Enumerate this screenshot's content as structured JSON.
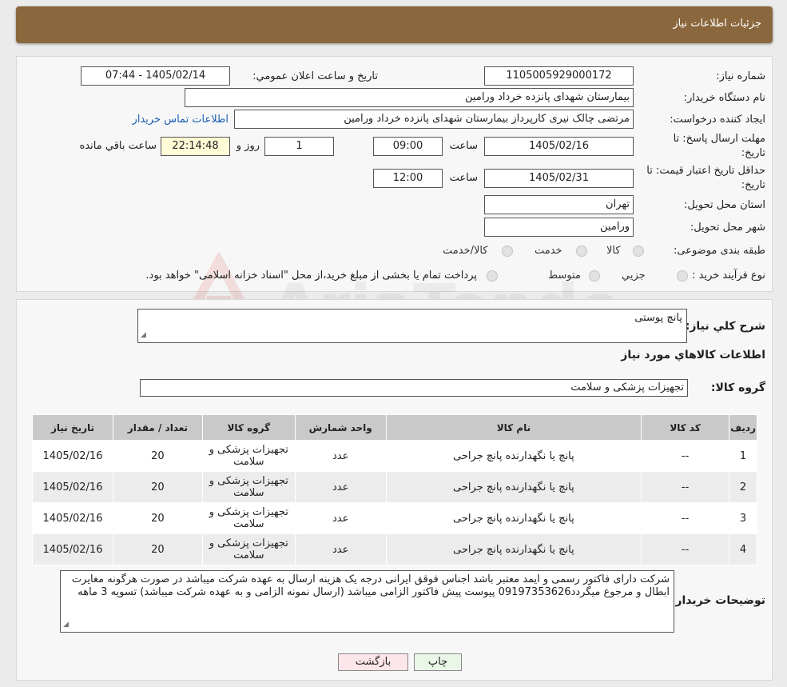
{
  "page_title": "جزئیات اطلاعات نیاز",
  "watermark_text": "AriaTender.neT",
  "need_info": {
    "need_number_label": "شماره نیاز:",
    "need_number": "1105005929000172",
    "announce_label": "تاريخ و ساعت اعلان عمومي:",
    "announce_value": "1405/02/14 - 07:44",
    "buyer_org_label": "نام دستگاه خريدار:",
    "buyer_org": "بیمارستان شهدای پانزده خرداد ورامین",
    "creator_label": "ايجاد كننده درخواست:",
    "creator": "مرتضی چالک نیری کارپرداز بیمارستان شهدای پانزده خرداد ورامین",
    "contact_link": "اطلاعات تماس خريدار",
    "reply_deadline_label_1": "مهلت ارسال پاسخ: تا",
    "reply_deadline_label_2": "تاريخ:",
    "reply_date": "1405/02/16",
    "time_label": "ساعت",
    "reply_time": "09:00",
    "days_value": "1",
    "days_label": "روز و",
    "remaining_time": "22:14:48",
    "remaining_label": "ساعت باقي مانده",
    "price_validity_label_1": "حداقل تاريخ اعتبار قيمت: تا",
    "price_validity_label_2": "تاريخ:",
    "price_validity_date": "1405/02/31",
    "price_validity_time": "12:00",
    "province_label": "استان محل تحويل:",
    "province": "تهران",
    "city_label": "شهر محل تحويل:",
    "city": "ورامین",
    "category_label": "طبقه بندی موضوعی:",
    "category_options": [
      "كالا",
      "خدمت",
      "كالا/خدمت"
    ],
    "purchase_type_label": "نوع فرآيند خريد :",
    "purchase_options": [
      "جزيي",
      "متوسط"
    ],
    "purchase_note": "پرداخت تمام يا بخشی از مبلغ خريد،از محل \"اسناد خزانه اسلامی\" خواهد بود."
  },
  "summary": {
    "general_desc_label": "شرح كلي نياز:",
    "general_desc": "پانچ پوستی",
    "goods_info_title": "اطلاعات كالاهاي مورد نياز",
    "goods_group_label": "گروه كالا:",
    "goods_group": "تجهیزات پزشکی و سلامت"
  },
  "table": {
    "headers": [
      "رديف",
      "كد كالا",
      "نام كالا",
      "واحد شمارش",
      "گروه كالا",
      "تعداد / مقدار",
      "تاريخ نياز"
    ],
    "rows": [
      [
        "1",
        "--",
        "پانچ یا نگهدارنده پانچ جراحی",
        "عدد",
        "تجهیزات پزشکی و سلامت",
        "20",
        "1405/02/16"
      ],
      [
        "2",
        "--",
        "پانچ یا نگهدارنده پانچ جراحی",
        "عدد",
        "تجهیزات پزشکی و سلامت",
        "20",
        "1405/02/16"
      ],
      [
        "3",
        "--",
        "پانچ یا نگهدارنده پانچ جراحی",
        "عدد",
        "تجهیزات پزشکی و سلامت",
        "20",
        "1405/02/16"
      ],
      [
        "4",
        "--",
        "پانچ یا نگهدارنده پانچ جراحی",
        "عدد",
        "تجهیزات پزشکی و سلامت",
        "20",
        "1405/02/16"
      ]
    ]
  },
  "buyer_notes_label": "توضيحات خريدار:",
  "buyer_notes": "شرکت دارای فاکتور رسمی و ایمد معتبر باشد اجناس فوقق ایرانی درجه یک هزینه ارسال به عهده شرکت میباشد در صورت هرگونه مغایرت ابطال و مرجوع میگردد09197353626 پیوست پیش فاکتور الزامی میباشد (ارسال نمونه الزامی و به عهده شرکت میباشد) تسویه 3 ماهه",
  "buttons": {
    "print": "چاپ",
    "back": "بازگشت"
  }
}
